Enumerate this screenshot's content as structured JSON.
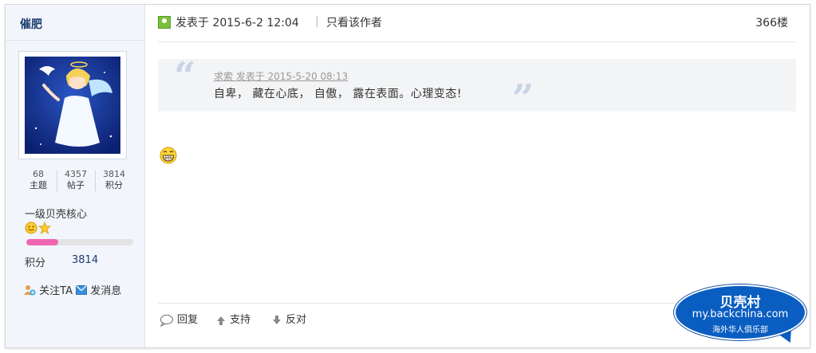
{
  "author": {
    "name": "催肥",
    "stats": [
      {
        "value": "68",
        "label": "主题"
      },
      {
        "value": "4357",
        "label": "帖子"
      },
      {
        "value": "3814",
        "label": "积分"
      }
    ],
    "rank": "一级贝壳核心",
    "progress_fraction": 0.3,
    "score_label": "积分",
    "score_value": "3814",
    "follow_label": "关注TA",
    "message_label": "发消息"
  },
  "post": {
    "meta": "发表于 2015-6-2 12:04",
    "separator": "|",
    "only_author": "只看该作者",
    "floor": "366楼",
    "quote": {
      "open_mark": "“",
      "close_mark": "”",
      "author_line": "求索 发表于 2015-5-20 08:13",
      "text": "自卑， 藏在心底， 自傲， 露在表面。心理变态!"
    },
    "footer": {
      "reply": "回复",
      "support": "支持",
      "oppose": "反对"
    }
  },
  "watermark": {
    "line1": "贝壳村",
    "line2": "my.backchina.com",
    "line3": "海外华人俱乐部"
  },
  "colors": {
    "accent": "#1a3b6e",
    "progress": "#f066b0",
    "watermark": "#0a5ec2"
  }
}
